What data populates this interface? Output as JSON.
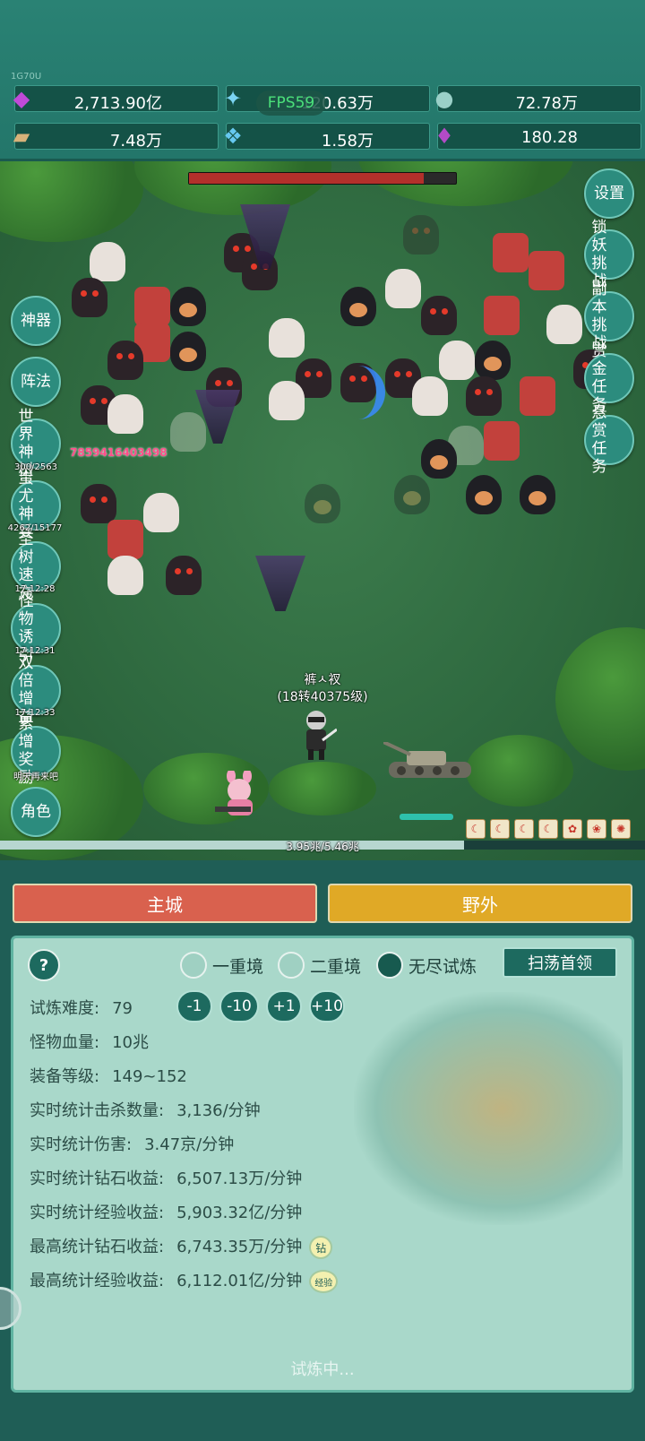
{
  "top": {
    "version": "1G70U",
    "fps": "FPS59",
    "resources": [
      {
        "name": "diamond-icon",
        "value": "2,713.90亿"
      },
      {
        "name": "crystal-icon",
        "value": "120.63万"
      },
      {
        "name": "orb-icon",
        "value": "72.78万"
      },
      {
        "name": "scroll-icon",
        "value": "7.48万"
      },
      {
        "name": "ice-gem-icon",
        "value": "1.58万"
      },
      {
        "name": "pouch-icon",
        "value": "180.28"
      }
    ]
  },
  "side_right": [
    {
      "label": "设置"
    },
    {
      "label": "锁妖挑战"
    },
    {
      "label": "副本挑战"
    },
    {
      "label": "赏金任务"
    },
    {
      "label": "悬赏任务"
    }
  ],
  "side_left": [
    {
      "label": "神器",
      "sub": ""
    },
    {
      "label": "阵法",
      "sub": ""
    },
    {
      "label": "世界神树",
      "sub": "300/2563"
    },
    {
      "label": "蚩尤神兵",
      "sub": "4262/15177"
    },
    {
      "label": "圣树速充",
      "sub": "17:12:28"
    },
    {
      "label": "怪物诱引",
      "sub": "17:12:31"
    },
    {
      "label": "双倍增益",
      "sub": "17:12:33"
    },
    {
      "label": "累增奖励",
      "sub": "明天再来吧"
    },
    {
      "label": "角色",
      "sub": ""
    }
  ],
  "battle": {
    "damage_number": "7859416403498",
    "player_name": "裤ㅅ衩",
    "player_level": "(18转40375级)",
    "boss_hp_fraction": 0.88,
    "exp_text": "3.95兆/5.46兆",
    "exp_fraction": 0.72
  },
  "tabs": {
    "city": "主城",
    "wild": "野外"
  },
  "panel": {
    "help": "?",
    "modes": [
      "一重境",
      "二重境",
      "无尽试炼"
    ],
    "sweep": "扫荡首领",
    "difficulty_label": "试炼难度:",
    "difficulty_value": "79",
    "adjust": [
      "-1",
      "-10",
      "+1",
      "+10"
    ],
    "stats": [
      {
        "label": "怪物血量:",
        "value": "10兆"
      },
      {
        "label": "装备等级:",
        "value": "149~152"
      },
      {
        "label": "实时统计击杀数量:",
        "value": "3,136/分钟"
      },
      {
        "label": "实时统计伤害:",
        "value": "3.47京/分钟"
      },
      {
        "label": "实时统计钻石收益:",
        "value": "6,507.13万/分钟"
      },
      {
        "label": "实时统计经验收益:",
        "value": "5,903.32亿/分钟"
      },
      {
        "label": "最高统计钻石收益:",
        "value": "6,743.35万/分钟"
      },
      {
        "label": "最高统计经验收益:",
        "value": "6,112.01亿/分钟"
      }
    ],
    "badge_diamond": "钻",
    "badge_exp": "经验",
    "status": "试炼中..."
  }
}
